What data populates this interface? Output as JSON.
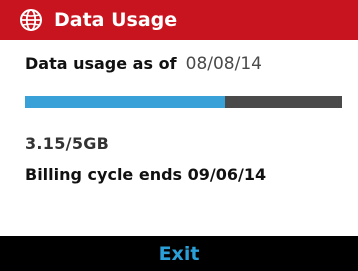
{
  "header": {
    "title": "Data Usage",
    "icon": "globe-icon",
    "background_color": "#c8141e"
  },
  "usage": {
    "as_of_label": "Data usage as of",
    "as_of_date": "08/08/14",
    "amount_text": "3.15/5GB",
    "progress_fraction": 0.63,
    "progress_color": "#3aa0d8",
    "track_color": "#4a4a4a"
  },
  "billing": {
    "text": "Billing cycle ends 09/06/14"
  },
  "footer": {
    "exit_label": "Exit"
  }
}
